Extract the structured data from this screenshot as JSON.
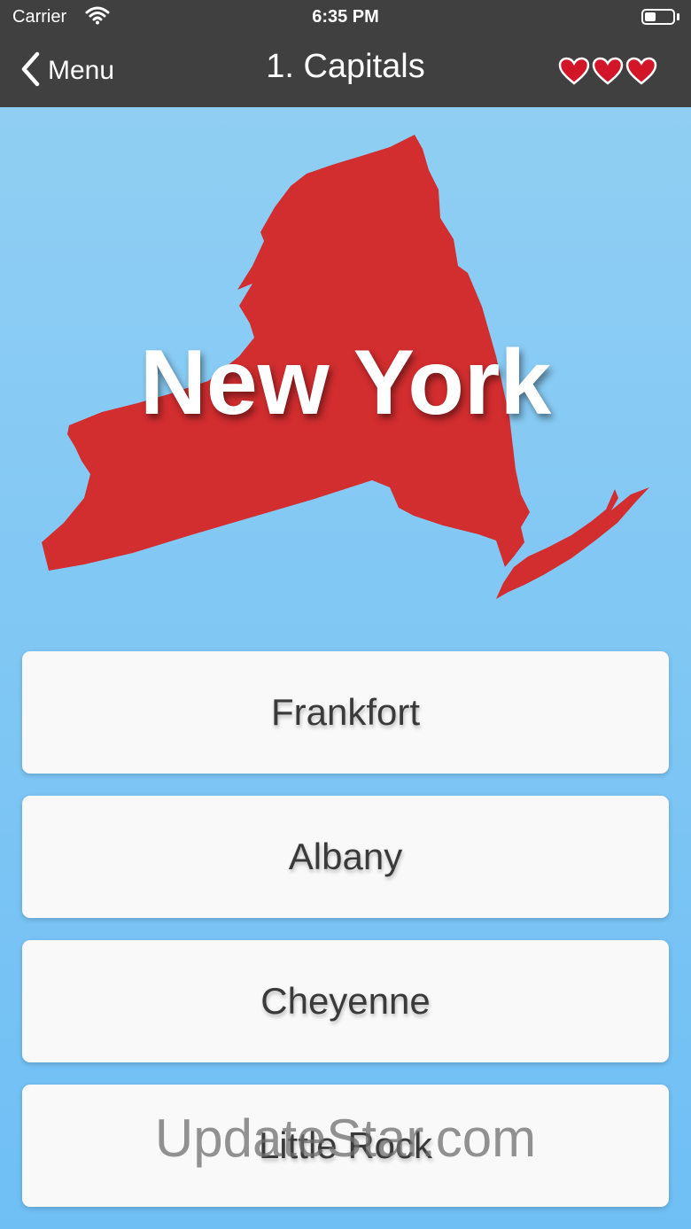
{
  "status_bar": {
    "carrier": "Carrier",
    "time": "6:35 PM"
  },
  "nav": {
    "back_label": "Menu",
    "title": "1. Capitals",
    "lives": 3
  },
  "quiz": {
    "state_name": "New York"
  },
  "answers": [
    {
      "label": "Frankfort"
    },
    {
      "label": "Albany"
    },
    {
      "label": "Cheyenne"
    },
    {
      "label": "Little Rock"
    }
  ],
  "watermark": "UpdateStar.com",
  "colors": {
    "nav_background": "#404040",
    "sky_top": "#93d0f3",
    "sky_bottom": "#6fbff5",
    "state_fill": "#d22d2f",
    "heart": "#d3152a",
    "answer_background": "#f9f9f9"
  },
  "icons": {
    "back": "chevron-left-icon",
    "wifi": "wifi-icon",
    "battery": "battery-icon",
    "life": "heart-icon"
  }
}
